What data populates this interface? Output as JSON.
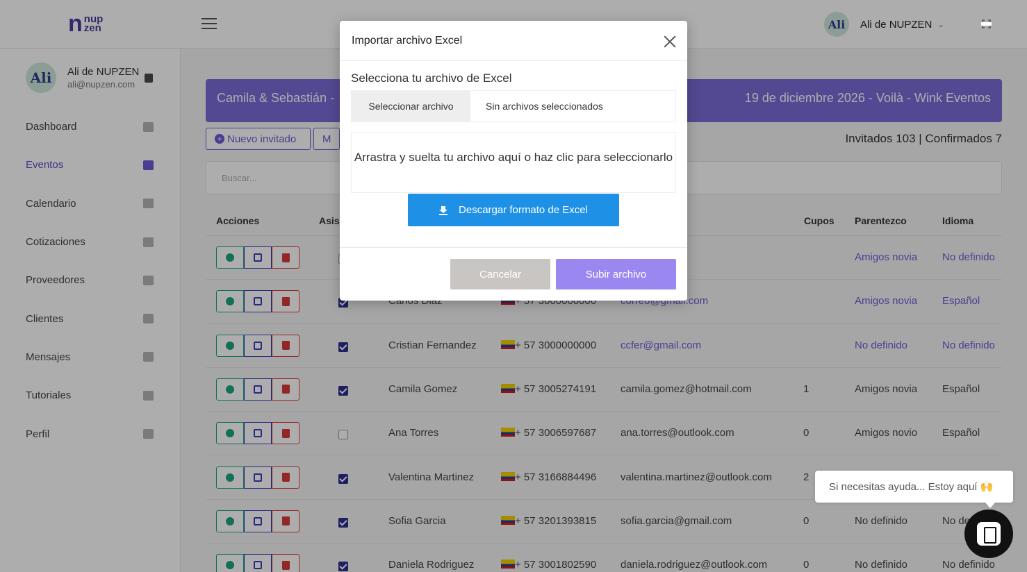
{
  "topbar": {
    "logo_mark": "n",
    "logo_line1": "nup",
    "logo_line2": "zen",
    "user_name": "Ali de NUPZEN",
    "avatar_text": "Ali"
  },
  "sidebar": {
    "user_name": "Ali de NUPZEN",
    "user_email": "ali@nupzen.com",
    "avatar_text": "Ali",
    "items": [
      {
        "label": "Dashboard",
        "icon": "dashboard-icon"
      },
      {
        "label": "Eventos",
        "icon": "cake-icon",
        "active": true
      },
      {
        "label": "Calendario",
        "icon": "calendar-icon"
      },
      {
        "label": "Cotizaciones",
        "icon": "hand-coins-icon"
      },
      {
        "label": "Proveedores",
        "icon": "truck-icon"
      },
      {
        "label": "Clientes",
        "icon": "users-icon"
      },
      {
        "label": "Mensajes",
        "icon": "message-icon"
      },
      {
        "label": "Tutoriales",
        "icon": "video-icon"
      },
      {
        "label": "Perfil",
        "icon": "user-icon"
      }
    ]
  },
  "banner": {
    "left": "Camila & Sebastián -",
    "right": "19 de diciembre 2026 - Voilà - Wink Eventos"
  },
  "toolbar": {
    "new_guest": "Nuevo invitado",
    "second_button": "M"
  },
  "stats": "Invitados 103 | Confirmados 7",
  "search": {
    "placeholder": "Buscar..."
  },
  "table": {
    "headers": {
      "acciones": "Acciones",
      "asistencia": "Asis",
      "cupos": "Cupos",
      "parentezco": "Parentezco",
      "idioma": "Idioma"
    },
    "rows": [
      {
        "name": "",
        "phone": "",
        "email": "",
        "cupos": "",
        "parentezco": "Amigos novia",
        "idioma": "No definido",
        "checked": false,
        "link": true
      },
      {
        "name": "Carlos Diaz",
        "phone": "+ 57 3000000000",
        "email": "correo@gmail.com",
        "cupos": "",
        "parentezco": "Amigos novia",
        "idioma": "Español",
        "checked": true,
        "link": true
      },
      {
        "name": "Cristian Fernandez",
        "phone": "+ 57 3000000000",
        "email": "ccfer@gmail.com",
        "cupos": "",
        "parentezco": "No definido",
        "idioma": "No definido",
        "checked": true,
        "link": true
      },
      {
        "name": "Camila Gomez",
        "phone": "+ 57 3005274191",
        "email": "camila.gomez@hotmail.com",
        "cupos": "1",
        "parentezco": "Amigos novia",
        "idioma": "Español",
        "checked": true,
        "link": false
      },
      {
        "name": "Ana Torres",
        "phone": "+ 57 3006597687",
        "email": "ana.torres@outlook.com",
        "cupos": "0",
        "parentezco": "Amigos novio",
        "idioma": "Español",
        "checked": false,
        "link": false
      },
      {
        "name": "Valentina Martinez",
        "phone": "+ 57 3166884496",
        "email": "valentina.martinez@outlook.com",
        "cupos": "2",
        "parentezco": "",
        "idioma": "",
        "checked": true,
        "link": false
      },
      {
        "name": "Sofia Garcia",
        "phone": "+ 57 3201393815",
        "email": "sofia.garcia@gmail.com",
        "cupos": "0",
        "parentezco": "No definido",
        "idioma": "No de",
        "checked": true,
        "link": false
      },
      {
        "name": "Daniela Rodriguez",
        "phone": "+ 57 3001802590",
        "email": "daniela.rodriguez@outlook.com",
        "cupos": "0",
        "parentezco": "No definido",
        "idioma": "No definido",
        "checked": true,
        "link": false
      }
    ]
  },
  "modal": {
    "title": "Importar archivo Excel",
    "select_label": "Selecciona tu archivo de Excel",
    "file_button": "Seleccionar archivo",
    "file_status": "Sin archivos seleccionados",
    "dropzone_text": "Arrastra y suelta tu archivo aquí o haz clic para seleccionarlo",
    "download_button": "Descargar formato de Excel",
    "cancel_button": "Cancelar",
    "upload_button": "Subir archivo"
  },
  "help": {
    "text": "Si necesitas ayuda... Estoy aquí 🙌"
  },
  "colors": {
    "accent": "#6d5bd6",
    "banner": "#7b6cd9",
    "download": "#1e90e5",
    "upload": "#9b87f0"
  }
}
